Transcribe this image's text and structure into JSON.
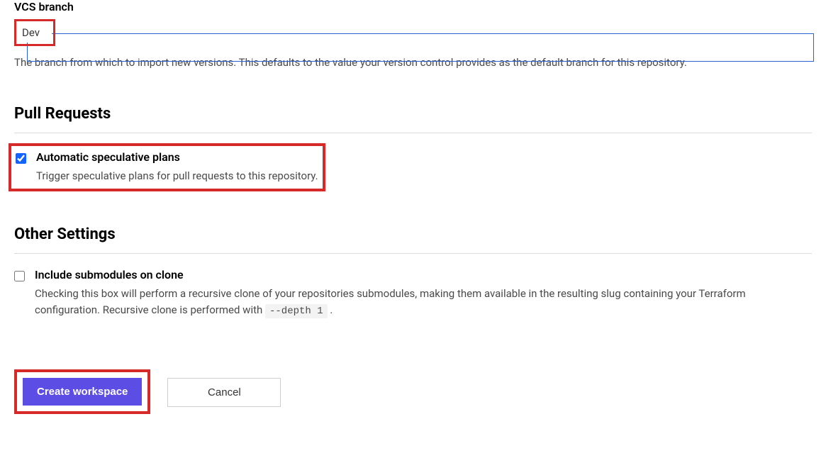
{
  "vcs": {
    "label": "VCS branch",
    "value": "Dev",
    "helper": "The branch from which to import new versions. This defaults to the value your version control provides as the default branch for this repository."
  },
  "pullRequests": {
    "heading": "Pull Requests",
    "speculative": {
      "checked": true,
      "label": "Automatic speculative plans",
      "description": "Trigger speculative plans for pull requests to this repository."
    }
  },
  "otherSettings": {
    "heading": "Other Settings",
    "submodules": {
      "checked": false,
      "label": "Include submodules on clone",
      "descriptionPrefix": "Checking this box will perform a recursive clone of your repositories submodules, making them available in the resulting slug containing your Terraform configuration. Recursive clone is performed with ",
      "code": "--depth 1",
      "descriptionSuffix": " ."
    }
  },
  "actions": {
    "create": "Create workspace",
    "cancel": "Cancel"
  }
}
